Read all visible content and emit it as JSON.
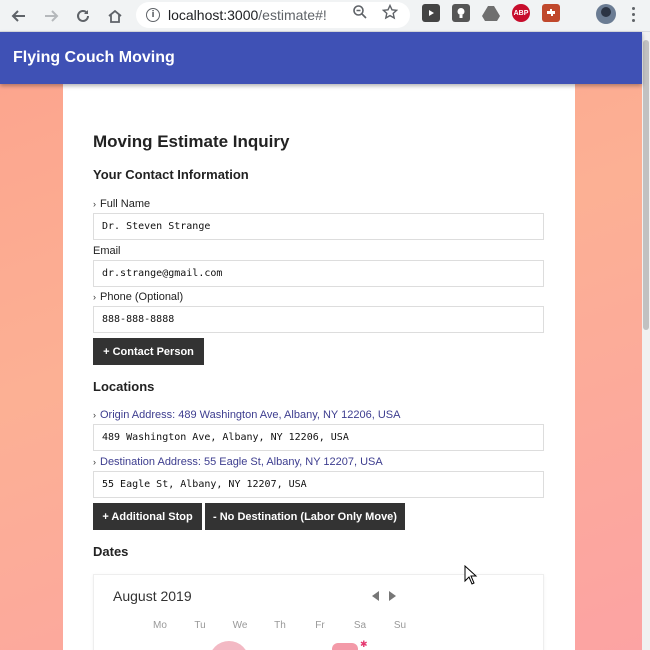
{
  "browser": {
    "url_host": "localhost:3000",
    "url_path": "/estimate#!",
    "extensions": [
      "youtube-ext-icon",
      "bulb-ext-icon",
      "drive-ext-icon",
      "abp-ext-icon",
      "puzzle-ext-icon"
    ],
    "abp_label": "ABP"
  },
  "app": {
    "title": "Flying Couch Moving"
  },
  "form": {
    "title": "Moving Estimate Inquiry",
    "contact": {
      "heading": "Your Contact Information",
      "full_name_label": "Full Name",
      "full_name_value": "Dr. Steven Strange",
      "email_label": "Email",
      "email_value": "dr.strange@gmail.com",
      "phone_label": "Phone (Optional)",
      "phone_value": "888-888-8888",
      "add_contact_button": "+ Contact Person"
    },
    "locations": {
      "heading": "Locations",
      "origin_label": "Origin Address: 489 Washington Ave, Albany, NY 12206, USA",
      "origin_value": "489 Washington Ave, Albany, NY 12206, USA",
      "destination_label": "Destination Address: 55 Eagle St, Albany, NY 12207, USA",
      "destination_value": "55 Eagle St, Albany, NY 12207, USA",
      "add_stop_button": "+ Additional Stop",
      "no_destination_button": "- No Destination (Labor Only Move)"
    },
    "dates": {
      "heading": "Dates",
      "month": "August 2019",
      "weekdays": [
        "Mo",
        "Tu",
        "We",
        "Th",
        "Fr",
        "Sa",
        "Su"
      ]
    }
  },
  "colors": {
    "appbar": "#3f51b5",
    "button": "#333333",
    "link_label": "#3d3d8f"
  }
}
